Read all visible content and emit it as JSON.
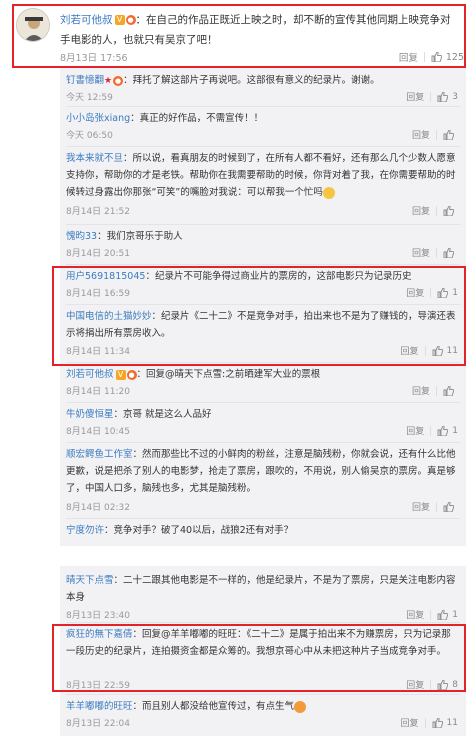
{
  "main_comment": {
    "username": "刘若可他叔",
    "text": "：在自己的作品正既近上映之时，却不断的宣传其他同期上映竞争对手电影的人，也就只有吴京了吧！",
    "time": "8月13日 17:56",
    "reply_label": "回复",
    "likes": "125"
  },
  "replies": [
    {
      "username": "钉書憶翻",
      "text": "：拜托了解这部片子再说吧。这部很有意义的纪录片。谢谢。",
      "time": "今天 12:59",
      "reply_label": "回复",
      "likes": "3"
    },
    {
      "username": "小小岛张xiang",
      "text": "：真正的好作品，不需宣传！！",
      "time": "今天 06:50",
      "reply_label": "回复",
      "likes": ""
    },
    {
      "username": "我本来就不旦",
      "text": "：所以说，看真朋友的时候到了，在所有人都不看好，还有那么几个少数人愿意支持你，帮助你的才是老铁。帮助你在我需要帮助的时候，你背对着了我，在你需要帮助的时候转过身露出你那张“可笑”的嘴脸对我说：可以帮我一个忙吗",
      "time": "8月14日 21:52",
      "reply_label": "回复",
      "likes": ""
    },
    {
      "username": "愧昀33",
      "text": "：我们京哥乐于助人",
      "time": "8月14日 20:51",
      "reply_label": "回复",
      "likes": ""
    },
    {
      "username": "用户5691815045",
      "text": "：纪录片不可能争得过商业片的票房的，这部电影只为记录历史",
      "time": "8月14日 16:59",
      "reply_label": "回复",
      "likes": "1"
    },
    {
      "username": "中国电信的土猫妙妙",
      "text": "：纪录片《二十二》不是竞争对手，拍出来也不是为了赚钱的，导演还表示将捐出所有票房收入。",
      "time": "8月14日 11:34",
      "reply_label": "回复",
      "likes": "11"
    },
    {
      "username": "刘若可他叔",
      "text": "：回复@晴天下点雪:之前晒建军大业的票根",
      "time": "8月14日 11:20",
      "reply_label": "回复",
      "likes": ""
    },
    {
      "username": "牛奶傻恒星",
      "text": "：京哥 就是这么人品好",
      "time": "8月14日 10:45",
      "reply_label": "回复",
      "likes": "1"
    },
    {
      "username": "顺宏鳄鱼工作室",
      "text": "：然而那些比不过的小鲜肉的粉丝，注意是脑残粉，你就会说，还有什么比他更歉，说是把杀了别人的电影梦，抢走了票房，跟吹的，不用说，别人偷吴京的票房。真是够了，中国人口多，脑残也多，尤其是脑残粉。",
      "time": "8月14日 02:32",
      "reply_label": "回复",
      "likes": ""
    },
    {
      "username": "宁度勿许",
      "text": "：竞争对手？破了40以后，战狼2还有对手？",
      "time": "8月14日 01:10",
      "reply_label": "回复",
      "likes": "1"
    }
  ],
  "replies2": [
    {
      "username": "晴天下点雪",
      "text": "：二十二跟其他电影是不一样的，他是纪录片，不是为了票房，只是关注电影内容本身",
      "time": "8月13日 23:40",
      "reply_label": "回复",
      "likes": "1"
    },
    {
      "username": "疯狂的無下嘉倩",
      "text": "：回复@羊羊嘟嘟的旺旺：《二十二》是属于拍出来不为赚票房，只为记录那一段历史的纪录片，连拍摄资金都是众筹的。我想京哥心中从未把这种片子当成竞争对手。",
      "time": "8月13日 22:59",
      "reply_label": "回复",
      "likes": "8"
    },
    {
      "username": "羊羊嘟嘟的旺旺",
      "text": "：而且别人都没给他宣传过，有点生气",
      "time": "8月13日 22:04",
      "reply_label": "回复",
      "likes": "11"
    }
  ]
}
